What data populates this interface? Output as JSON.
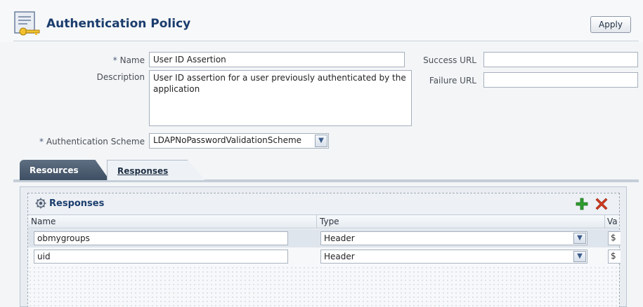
{
  "header": {
    "title": "Authentication Policy",
    "apply_label": "Apply",
    "icon": "policy-key-icon"
  },
  "form": {
    "name_required": "*",
    "name_label": "Name",
    "name_value": "User ID Assertion",
    "description_label": "Description",
    "description_value": "User ID assertion for a user previously authenticated by the application",
    "success_url_label": "Success URL",
    "success_url_value": "",
    "failure_url_label": "Failure URL",
    "failure_url_value": "",
    "scheme_required": "*",
    "scheme_label": "Authentication Scheme",
    "scheme_value": "LDAPNoPasswordValidationScheme"
  },
  "tabs": [
    {
      "label": "Resources",
      "active": false
    },
    {
      "label": "Responses",
      "active": true
    }
  ],
  "responses": {
    "title": "Responses",
    "add_icon": "add-icon",
    "delete_icon": "delete-icon",
    "columns": [
      "Name",
      "Type",
      "Va"
    ],
    "rows": [
      {
        "name": "obmygroups",
        "type": "Header",
        "value": "$"
      },
      {
        "name": "uid",
        "type": "Header",
        "value": "$"
      }
    ]
  },
  "colors": {
    "title": "#1b3d6d",
    "tab_inactive": "#4f5f73",
    "add": "#2e9e2e",
    "delete": "#d23a1f"
  }
}
